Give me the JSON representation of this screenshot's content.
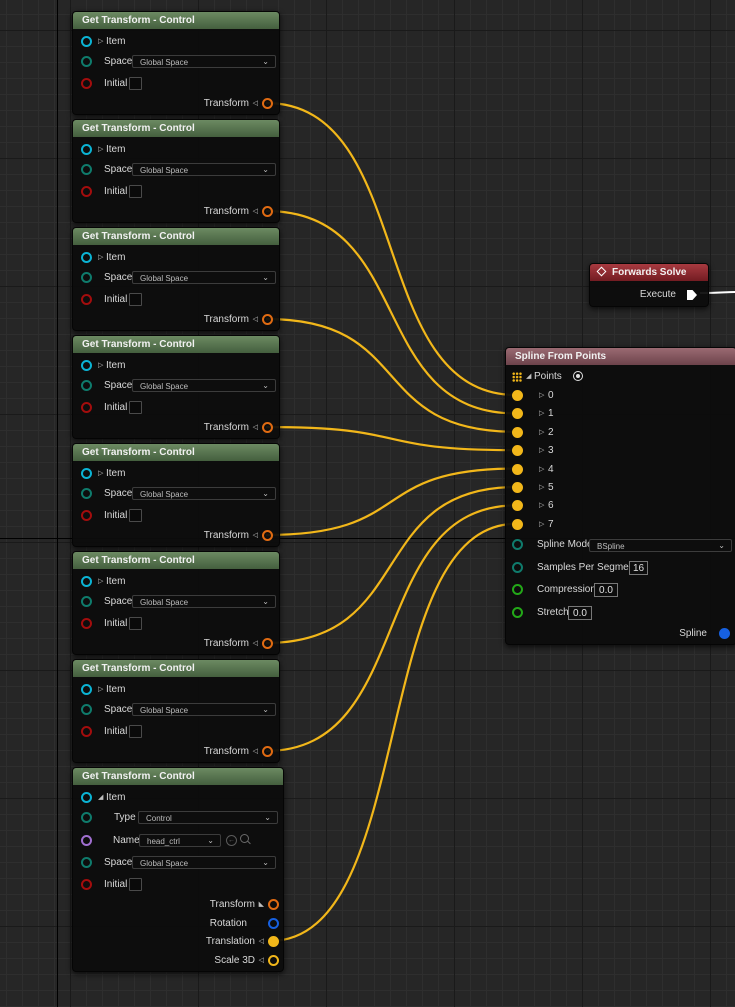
{
  "transform_nodes": [
    {
      "title": "Get Transform - Control",
      "item_label": "Item",
      "space_label": "Space",
      "space_value": "Global Space",
      "initial_label": "Initial",
      "output_label": "Transform"
    },
    {
      "title": "Get Transform - Control",
      "item_label": "Item",
      "space_label": "Space",
      "space_value": "Global Space",
      "initial_label": "Initial",
      "output_label": "Transform"
    },
    {
      "title": "Get Transform - Control",
      "item_label": "Item",
      "space_label": "Space",
      "space_value": "Global Space",
      "initial_label": "Initial",
      "output_label": "Transform"
    },
    {
      "title": "Get Transform - Control",
      "item_label": "Item",
      "space_label": "Space",
      "space_value": "Global Space",
      "initial_label": "Initial",
      "output_label": "Transform"
    },
    {
      "title": "Get Transform - Control",
      "item_label": "Item",
      "space_label": "Space",
      "space_value": "Global Space",
      "initial_label": "Initial",
      "output_label": "Transform"
    },
    {
      "title": "Get Transform - Control",
      "item_label": "Item",
      "space_label": "Space",
      "space_value": "Global Space",
      "initial_label": "Initial",
      "output_label": "Transform"
    },
    {
      "title": "Get Transform - Control",
      "item_label": "Item",
      "space_label": "Space",
      "space_value": "Global Space",
      "initial_label": "Initial",
      "output_label": "Transform"
    }
  ],
  "expanded_node": {
    "title": "Get Transform - Control",
    "item_label": "Item",
    "type_label": "Type",
    "type_value": "Control",
    "name_label": "Name",
    "name_value": "head_ctrl",
    "space_label": "Space",
    "space_value": "Global Space",
    "initial_label": "Initial",
    "outputs": [
      "Transform",
      "Rotation",
      "Translation",
      "Scale 3D"
    ]
  },
  "forwards_solve": {
    "title": "Forwards Solve",
    "execute_label": "Execute"
  },
  "spline_node": {
    "title": "Spline From Points",
    "points_label": "Points",
    "point_indices": [
      "0",
      "1",
      "2",
      "3",
      "4",
      "5",
      "6",
      "7"
    ],
    "spline_mode_label": "Spline Mode",
    "spline_mode_value": "BSpline",
    "samples_label": "Samples Per Segment",
    "samples_value": "16",
    "compression_label": "Compression",
    "compression_value": "0.0",
    "stretch_label": "Stretch",
    "stretch_value": "0.0",
    "output_label": "Spline"
  },
  "colors": {
    "wire": "#f2b71a",
    "node_header": "#5a7551",
    "spline_header": "#8a5a62",
    "event_header": "#8e2a30",
    "pin_item": "#0bb4d4",
    "pin_space": "#0f7b6c",
    "pin_bool": "#a30d0d",
    "pin_transform": "#e06b12",
    "pin_vector": "#f2b71a",
    "pin_name": "#a06fd0",
    "pin_float": "#23a818",
    "pin_spline": "#1660e0"
  },
  "icons": {
    "expand": "triangle-right-icon",
    "collapse": "triangle-down-icon",
    "dropdown": "chevron-down-icon",
    "exec": "exec-arrow-icon",
    "array": "array-grid-icon",
    "add": "add-pin-icon",
    "browse": "browse-arrow-icon",
    "search": "magnifier-icon"
  }
}
